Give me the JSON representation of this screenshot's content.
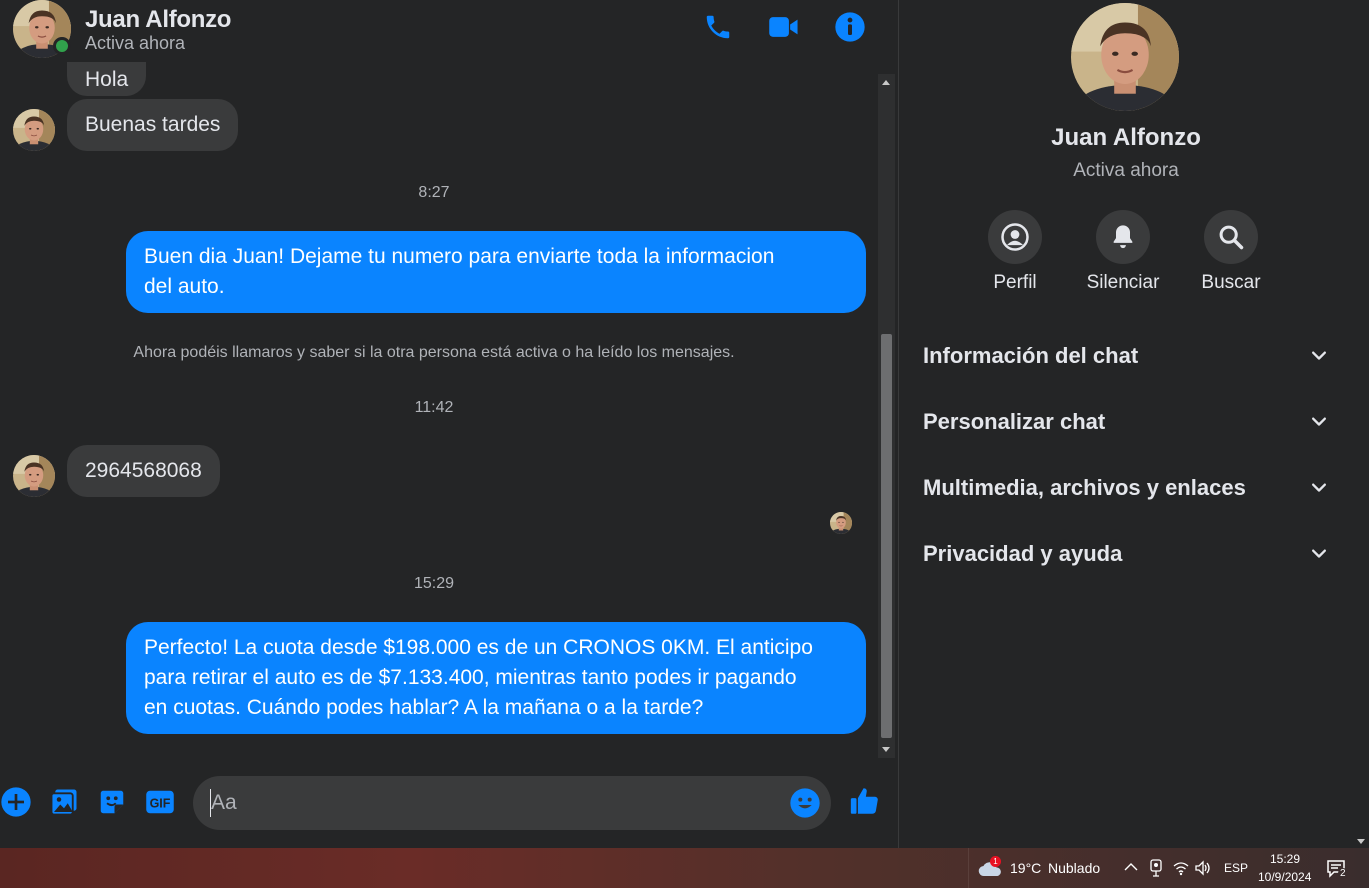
{
  "header": {
    "name": "Juan Alfonzo",
    "status": "Activa ahora",
    "icons": [
      "phone-icon",
      "video-icon",
      "info-icon"
    ]
  },
  "conversation": {
    "partial_top_text": "Hola",
    "messages": [
      {
        "type": "incoming",
        "text": "Buenas tardes"
      },
      {
        "type": "time",
        "text": "8:27"
      },
      {
        "type": "outgoing",
        "lines": [
          "Buen dia Juan! Dejame tu numero para enviarte toda la informacion",
          "del auto."
        ]
      },
      {
        "type": "system",
        "text": "Ahora podéis llamaros y saber si la otra persona está activa o ha leído los mensajes."
      },
      {
        "type": "time",
        "text": "11:42"
      },
      {
        "type": "incoming",
        "text": "2964568068"
      },
      {
        "type": "time",
        "text": "15:29"
      },
      {
        "type": "outgoing",
        "lines": [
          "Perfecto! La cuota desde $198.000 es de un CRONOS 0KM. El anticipo",
          "para retirar el auto es de $7.133.400, mientras tanto podes ir pagando",
          "en cuotas. Cuándo podes hablar? A la mañana o a la tarde?"
        ]
      }
    ]
  },
  "composer": {
    "placeholder": "Aa",
    "gif_label": "GIF",
    "icons": [
      "plus-icon",
      "image-icon",
      "sticker-icon",
      "gif-icon",
      "emoji-icon",
      "like-icon"
    ]
  },
  "sidebar": {
    "name": "Juan Alfonzo",
    "status": "Activa ahora",
    "actions": [
      {
        "label": "Perfil",
        "icon": "profile-icon"
      },
      {
        "label": "Silenciar",
        "icon": "bell-icon"
      },
      {
        "label": "Buscar",
        "icon": "search-icon"
      }
    ],
    "sections": [
      {
        "title": "Información del chat"
      },
      {
        "title": "Personalizar chat"
      },
      {
        "title": "Multimedia, archivos y enlaces"
      },
      {
        "title": "Privacidad y ayuda"
      }
    ]
  },
  "taskbar": {
    "weather_temp": "19°C",
    "weather_desc": "Nublado",
    "weather_badge": "1",
    "language": "ESP",
    "time": "15:29",
    "date": "10/9/2024",
    "notifications": "2"
  },
  "colors": {
    "background": "#242526",
    "bubble_incoming": "#3a3b3c",
    "bubble_outgoing": "#0a84ff",
    "accent": "#0a84ff",
    "online": "#31a24c"
  }
}
